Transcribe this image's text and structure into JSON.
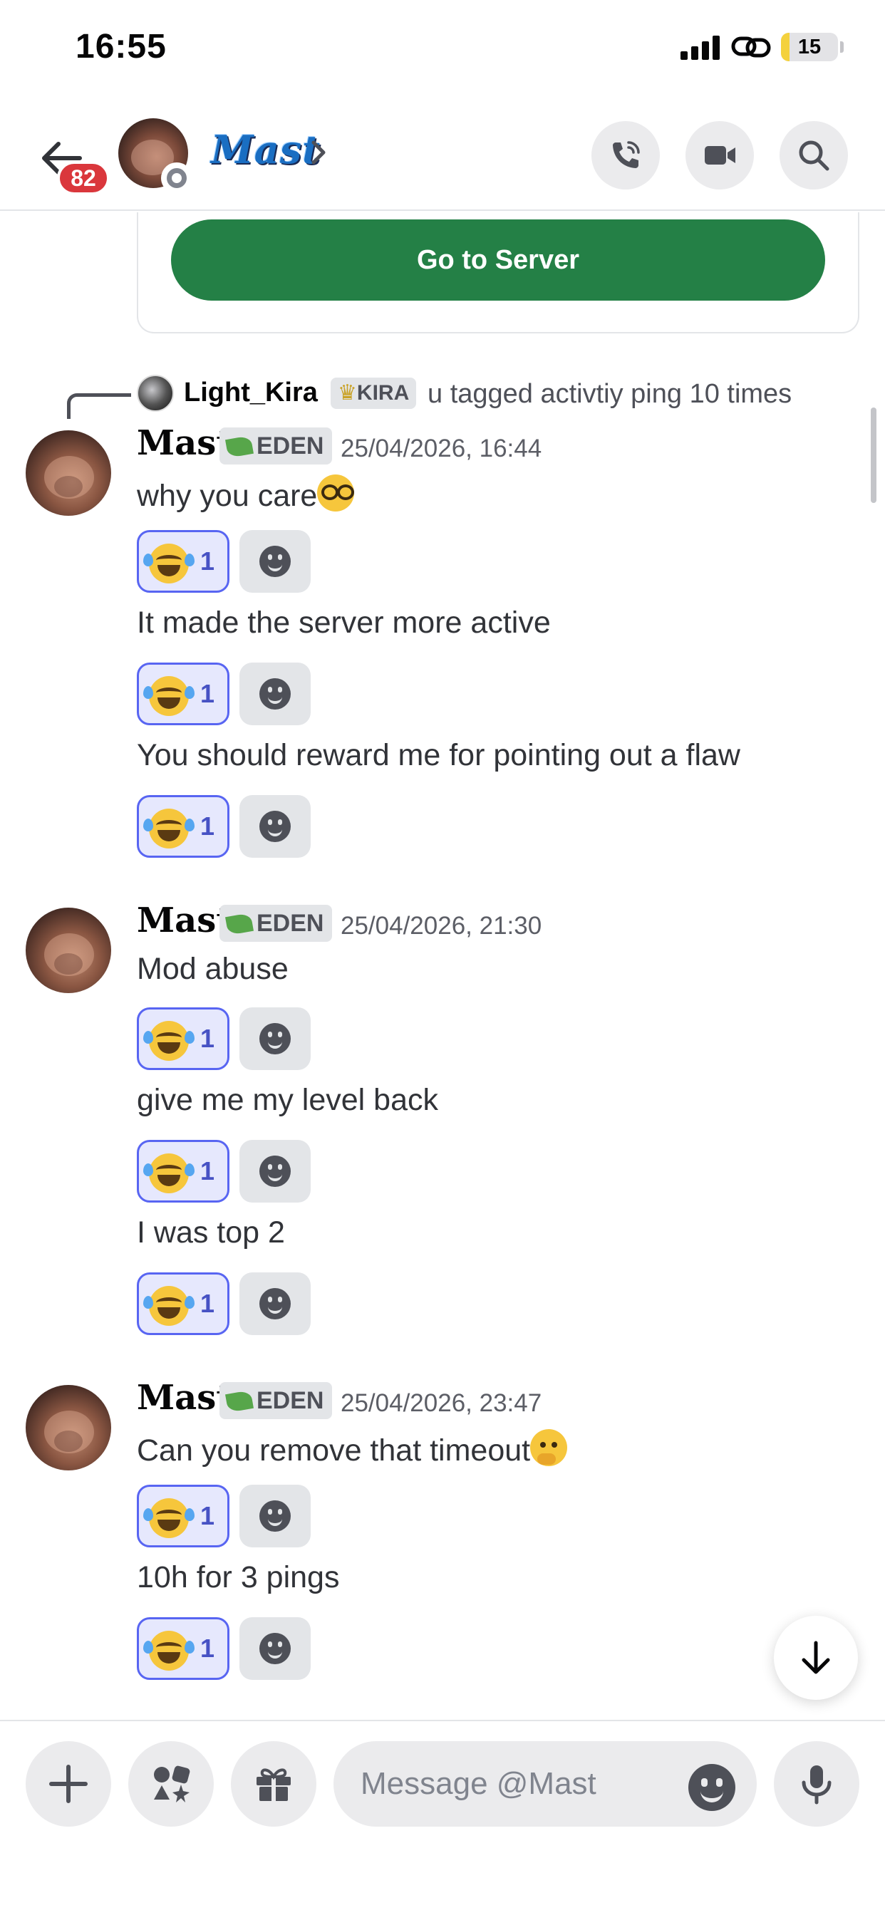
{
  "status_bar": {
    "time": "16:55",
    "battery_percent": "15",
    "battery_level": 0.15,
    "icons": [
      "cellular-signal-icon",
      "link-icon",
      "battery-icon"
    ]
  },
  "header": {
    "back_icon": "arrow-left-icon",
    "unread_count": "82",
    "channel_name": "Mast",
    "status": "offline",
    "actions": [
      "phone-call-icon",
      "video-camera-icon",
      "search-icon"
    ]
  },
  "embed": {
    "button_label": "Go to Server",
    "button_color": "#248046"
  },
  "reply_preview": {
    "author": "Light_Kira",
    "tag": "KIRA",
    "text": "u tagged activtiy ping 10 times"
  },
  "message_groups": [
    {
      "author": "Mast",
      "role_tag": "EDEN",
      "timestamp": "25/04/2026, 16:44",
      "messages": [
        {
          "text": "why you care",
          "emoji": "nerd-face",
          "reaction_count": "1"
        },
        {
          "text": "It made the server more active",
          "reaction_count": "1"
        },
        {
          "text": "You should reward me for pointing out a flaw",
          "reaction_count": "1"
        }
      ]
    },
    {
      "author": "Mast",
      "role_tag": "EDEN",
      "timestamp": "25/04/2026, 21:30",
      "messages": [
        {
          "text": "Mod abuse",
          "reaction_count": "1"
        },
        {
          "text": "give me my level back",
          "reaction_count": "1"
        },
        {
          "text": "I was top 2",
          "reaction_count": "1"
        }
      ]
    },
    {
      "author": "Mast",
      "role_tag": "EDEN",
      "timestamp": "25/04/2026, 23:47",
      "messages": [
        {
          "text": "Can you remove that timeout",
          "emoji": "thinking-face",
          "reaction_count": "1"
        },
        {
          "text": "10h for 3 pings",
          "reaction_count": "1"
        }
      ]
    }
  ],
  "reaction_emoji": "face-with-tears-of-joy",
  "composer": {
    "placeholder": "Message @Mast",
    "value": "",
    "buttons": [
      "plus-icon",
      "apps-icon",
      "gift-icon",
      "emoji-icon",
      "microphone-icon"
    ]
  },
  "colors": {
    "accent": "#5865f2",
    "badge_red": "#da373c",
    "reaction_bg": "#e6e8fd"
  }
}
